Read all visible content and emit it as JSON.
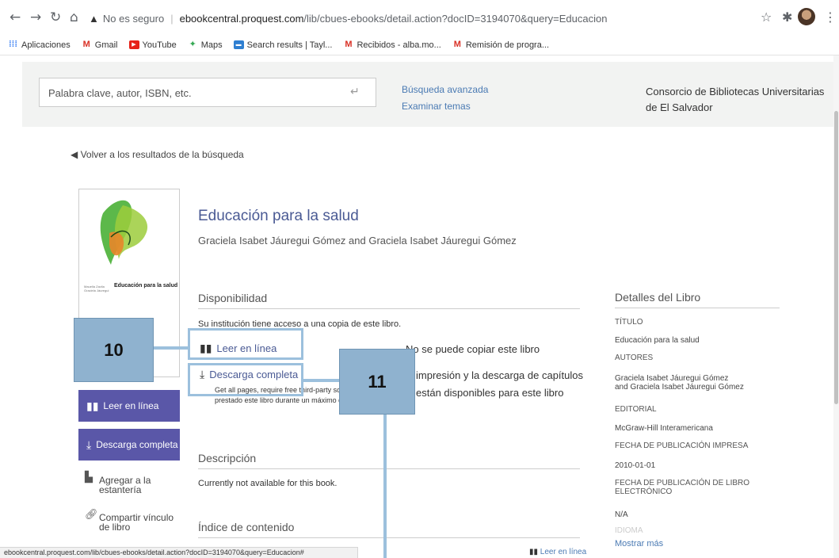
{
  "browser": {
    "security_label": "No es seguro",
    "url_host": "ebookcentral.proquest.com",
    "url_path": "/lib/cbues-ebooks/detail.action?docID=3194070&query=Educacion",
    "bookmarks": [
      {
        "label": "Aplicaciones",
        "icon": "apps-grid-icon",
        "color": "#4285f4"
      },
      {
        "label": "Gmail",
        "icon": "gmail-icon",
        "color": "#d93025"
      },
      {
        "label": "YouTube",
        "icon": "youtube-icon",
        "color": "#e62117"
      },
      {
        "label": "Maps",
        "icon": "maps-icon",
        "color": "#34a853"
      },
      {
        "label": "Search results | Tayl...",
        "icon": "search-results-icon",
        "color": "#2f7fd1"
      },
      {
        "label": "Recibidos - alba.mo...",
        "icon": "gmail-icon",
        "color": "#d93025"
      },
      {
        "label": "Remisión de progra...",
        "icon": "gmail-icon",
        "color": "#d93025"
      }
    ],
    "status_url": "ebookcentral.proquest.com/lib/cbues-ebooks/detail.action?docID=3194070&query=Educacion#"
  },
  "search": {
    "placeholder": "Palabra clave, autor, ISBN, etc.",
    "advanced_label": "Búsqueda avanzada",
    "browse_label": "Examinar temas"
  },
  "institution": "Consorcio de Bibliotecas Universitarias de El Salvador",
  "back_label": "Volver a los resultados de la búsqueda",
  "cover": {
    "title": "Educación para la salud",
    "authors": "Mauella Zavila Graciela Jáuregui"
  },
  "sidebar": {
    "read_online": "Leer en línea",
    "full_download": "Descarga completa",
    "add_shelf": "Agregar a la estantería",
    "share_link": "Compartir vínculo de libro"
  },
  "book": {
    "title": "Educación para la salud",
    "authors": "Graciela Isabet Jáuregui Gómez and Graciela Isabet Jáuregui Gómez"
  },
  "availability": {
    "heading": "Disponibilidad",
    "access_text": "Su institución tiene acceso a una copia de este libro.",
    "read_online": "Leer en línea",
    "full_download": "Descarga completa",
    "download_note_1": "Get all pages, require free third-party softw",
    "download_note_2": "prestado este libro durante un máximo de",
    "no_copy": "No se puede copiar este libro",
    "print_note_1": "impresión y la descarga de capítulos",
    "print_note_2": "están disponibles para este libro"
  },
  "description": {
    "heading": "Descripción",
    "text": "Currently not available for this book."
  },
  "toc": {
    "heading": "Índice de contenido",
    "read_online": "Leer en línea"
  },
  "details": {
    "heading": "Detalles del Libro",
    "title_label": "TÍTULO",
    "title_value": "Educación para la salud",
    "authors_label": "AUTORES",
    "authors_value_1": "Graciela Isabet Jáuregui Gómez",
    "authors_value_2": "and Graciela Isabet Jáuregui Gómez",
    "publisher_label": "EDITORIAL",
    "publisher_value": "McGraw-Hill Interamericana",
    "print_date_label": "FECHA DE PUBLICACIÓN IMPRESA",
    "print_date_value": "2010-01-01",
    "ebook_date_label": "FECHA DE PUBLICACIÓN DE LIBRO ELECTRÓNICO",
    "ebook_date_value": "N/A",
    "language_label": "IDIOMA",
    "more_label": "Mostrar más"
  },
  "annotations": {
    "step_10": "10",
    "step_11": "11",
    "color": "#8fb2cf"
  }
}
